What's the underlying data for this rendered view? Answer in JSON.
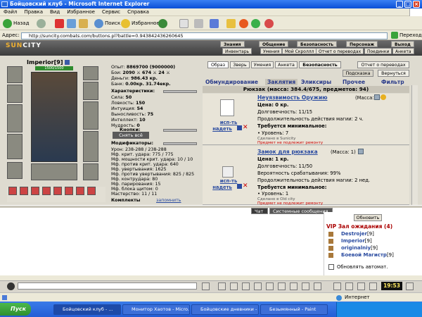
{
  "window": {
    "title": "Бойцовский клуб - Microsoft Internet Explorer"
  },
  "menu": [
    "Файл",
    "Правка",
    "Вид",
    "Избранное",
    "Сервис",
    "Справка"
  ],
  "toolbar": {
    "back": "Назад",
    "search": "Поиск",
    "favorites": "Избранное"
  },
  "address": {
    "label": "Адрес:",
    "url": "http://suncity.combats.com/buttons.pl?battle=0.943842436260645",
    "go": "Переход"
  },
  "site": {
    "logo_a": "SUN",
    "logo_b": "CITY",
    "nav_top": [
      "Знания",
      "Общение",
      "Безопасность",
      "Персонаж",
      "Выход"
    ],
    "nav_bottom": [
      "Инвентарь",
      "Умения",
      "Мой Скроллл",
      "Отчет о переводах",
      "Поединки",
      "Анкета"
    ]
  },
  "character": {
    "name": "Imperior",
    "level": "[9]",
    "hp": "1500/1500",
    "stats": [
      {
        "label": "Опыт:",
        "value": "8869700 (9000000)"
      },
      {
        "label": "Бои:",
        "value": "2090 ⚔ 674 ⚔ 24 ⚔"
      },
      {
        "label": "Деньги:",
        "value": "986.43 кр."
      },
      {
        "label": "Банк:",
        "value": "0.00кр. 31.74екр."
      }
    ],
    "char_header": "Характеристики:",
    "attributes": [
      {
        "label": "Сила:",
        "value": "50"
      },
      {
        "label": "Ловкость:",
        "value": "150"
      },
      {
        "label": "Интуиция:",
        "value": "54"
      },
      {
        "label": "Выносливость:",
        "value": "75"
      },
      {
        "label": "Интеллект:",
        "value": "10"
      },
      {
        "label": "Мудрость:",
        "value": "0"
      }
    ],
    "knopki": "Кнопки:",
    "remove_all": "Снять всё",
    "mods_header": "Модификаторы:",
    "mods": [
      {
        "label": "Урон:",
        "value": "238-288 / 238-288"
      },
      {
        "label": "Мф. крит. удара:",
        "value": "775 / 775"
      },
      {
        "label": "Мф. мощности крит. удара:",
        "value": "10 / 10"
      },
      {
        "label": "Мф. против крит. удара:",
        "value": "640"
      },
      {
        "label": "Мф. увертывания:",
        "value": "1625"
      },
      {
        "label": "Мф. против увертывания:",
        "value": "825 / 825"
      },
      {
        "label": "Мф. контрудара:",
        "value": "80"
      },
      {
        "label": "Мф. парирования:",
        "value": "15"
      },
      {
        "label": "Мф. блока щитом:",
        "value": "0"
      },
      {
        "label": "Мастерство:",
        "value": "11 / 11"
      }
    ],
    "sets": "Комплекты",
    "remember": "запомнить"
  },
  "right_tabs": {
    "row1": [
      "Образ",
      "Зверь",
      "Умения",
      "Анкета",
      "Безопасность",
      "Отчет о переводах"
    ],
    "row2": [
      "Подсказка",
      "Вернуться"
    ]
  },
  "categories": [
    "Обмундирование",
    "Заклятия",
    "Эликсиры",
    "Прочее",
    "Фильтр"
  ],
  "bag_title": "Рюкзак (масса: 384.4/675, предметов: 94)",
  "items": [
    {
      "name": "Неуязвимость Оружию",
      "mass": "(Масса: 1)",
      "use": "исп-ть",
      "wear": "надеть",
      "lines": [
        "Цена: 0 кр.",
        "Долговечность: 11/15",
        "Продолжительность действия магии: 2 ч.",
        "Требуется минимальное:",
        "• Уровень: 7",
        "Сделано в Sunicity"
      ],
      "note": "Предмет не подлежит ремонту"
    },
    {
      "name": "Замок для рюкзака",
      "mass": "(Масса: 1)",
      "use": "исп-ть",
      "wear": "надеть",
      "lines": [
        "Цена: 1 кр.",
        "Долговечность: 11/50",
        "Вероятность срабатывания: 99%",
        "Продолжительность действия магии: 2 нед.",
        "Требуется минимальное:",
        "• Уровень: 1",
        "Сделано в Old city"
      ],
      "note": "Предмет не подлежит ремонту"
    }
  ],
  "chat": {
    "tab_chat": "Чат",
    "tab_system": "Системные сообщения",
    "refresh": "Обновить",
    "room": "VIP Зал ожидания (4)",
    "users": [
      {
        "name": "Destrojer",
        "level": "[9]"
      },
      {
        "name": "Imperior",
        "level": "[9]"
      },
      {
        "name": "originalniy",
        "level": "[9]"
      },
      {
        "name": "Боевой Магистр",
        "level": "[9]"
      }
    ],
    "auto_refresh": "Обновлять автомат."
  },
  "clock": "19:53",
  "status": {
    "zone": "Интернет"
  },
  "taskbar": {
    "start": "Пуск",
    "tasks": [
      "Бойцовский клуб - ...",
      "Монитор Хаотов - Micro...",
      "Бойцовские дневники - ...",
      "Безымянный - Paint"
    ]
  },
  "colors": {
    "title_blue": "#0a4fd6",
    "link_blue": "#2a4ba0",
    "hp_green": "#2e8b2e",
    "warning_red": "#cc0000",
    "taskbar_blue": "#245ed6"
  }
}
